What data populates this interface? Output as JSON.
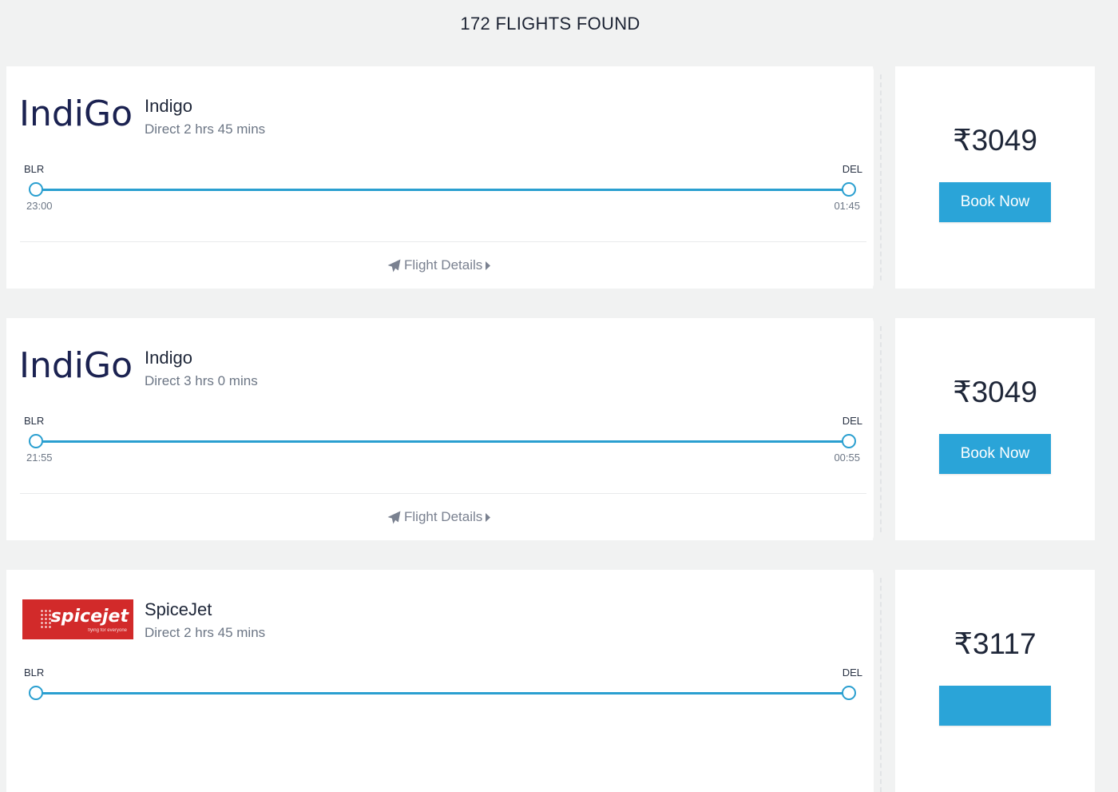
{
  "header": {
    "results_count_label": "172 FLIGHTS FOUND"
  },
  "colors": {
    "accent": "#2aa4d8",
    "route_line": "#2a9fd0",
    "page_bg": "#f1f2f2",
    "spicejet_red": "#d22a2a"
  },
  "flights": [
    {
      "logo_text": "IndiGo",
      "logo_icon": "indigo-logo",
      "airline": "Indigo",
      "duration": "Direct 2 hrs 45 mins",
      "from_code": "BLR",
      "to_code": "DEL",
      "depart_time": "23:00",
      "arrive_time": "01:45",
      "details_label": "Flight Details",
      "price": "₹3049",
      "book_label": "Book Now"
    },
    {
      "logo_text": "IndiGo",
      "logo_icon": "indigo-logo",
      "airline": "Indigo",
      "duration": "Direct 3 hrs 0 mins",
      "from_code": "BLR",
      "to_code": "DEL",
      "depart_time": "21:55",
      "arrive_time": "00:55",
      "details_label": "Flight Details",
      "price": "₹3049",
      "book_label": "Book Now"
    },
    {
      "logo_text": "spicejet",
      "logo_tagline": "flying for everyone",
      "logo_icon": "spicejet-logo",
      "airline": "SpiceJet",
      "duration": "Direct 2 hrs 45 mins",
      "from_code": "BLR",
      "to_code": "DEL",
      "price": "₹3117"
    }
  ]
}
